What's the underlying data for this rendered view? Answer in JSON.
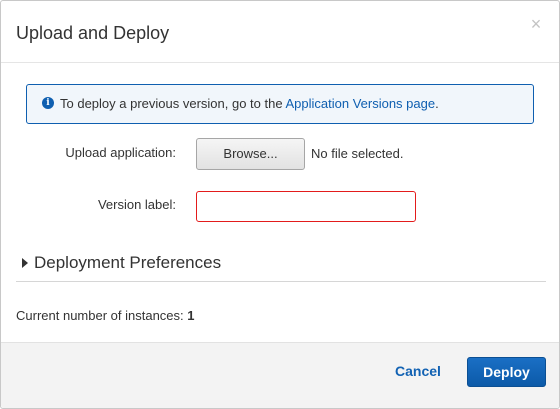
{
  "dialog": {
    "title": "Upload and Deploy",
    "close_glyph": "×"
  },
  "info": {
    "icon": "info-circle-icon",
    "text_before": "To deploy a previous version, go to the ",
    "link_text": "Application Versions page",
    "text_after": "."
  },
  "upload": {
    "label": "Upload application:",
    "browse_label": "Browse...",
    "file_status": "No file selected."
  },
  "version": {
    "label": "Version label:",
    "value": "",
    "placeholder": ""
  },
  "preferences": {
    "label": "Deployment Preferences",
    "icon": "caret-right-icon"
  },
  "instances": {
    "label": "Current number of instances: ",
    "count": "1"
  },
  "footer": {
    "cancel_label": "Cancel",
    "deploy_label": "Deploy"
  },
  "colors": {
    "accent": "#0f5fb0",
    "error_border": "#e31b1b",
    "info_bg": "#f1f6fb",
    "footer_bg": "#f3f3f3"
  }
}
